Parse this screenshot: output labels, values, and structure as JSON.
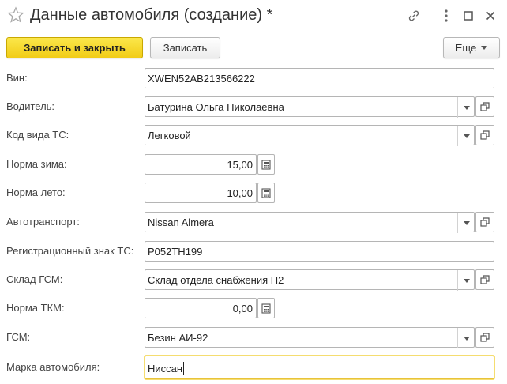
{
  "window": {
    "title": "Данные автомобиля (создание) *",
    "icons": [
      "star-icon",
      "link-icon",
      "more-vertical-icon",
      "maximize-icon",
      "close-icon"
    ]
  },
  "toolbar": {
    "save_close_label": "Записать и закрыть",
    "save_label": "Записать",
    "more_label": "Еще"
  },
  "colors": {
    "primary_button": "#f5d726",
    "active_border": "#e8c33a",
    "field_border": "#b5b5b5"
  },
  "form": {
    "vin": {
      "label": "Вин:",
      "value": "XWEN52AB213566222"
    },
    "driver": {
      "label": "Водитель:",
      "value": "Батурина Ольга Николаевна"
    },
    "vehicle_type_code": {
      "label": "Код вида ТС:",
      "value": "Легковой"
    },
    "winter_norm": {
      "label": "Норма зима:",
      "value": "15,00"
    },
    "summer_norm": {
      "label": "Норма лето:",
      "value": "10,00"
    },
    "vehicle": {
      "label": "Автотранспорт:",
      "value": "Nissan Almera"
    },
    "registration_plate": {
      "label": "Регистрационный знак ТС:",
      "value": "Р052ТН199"
    },
    "fuel_warehouse": {
      "label": "Склад ГСМ:",
      "value": "Склад отдела снабжения П2"
    },
    "tkm_norm": {
      "label": "Норма ТКМ:",
      "value": "0,00"
    },
    "fuel": {
      "label": "ГСМ:",
      "value": "Безин АИ-92"
    },
    "car_brand": {
      "label": "Марка автомобиля:",
      "value": "Ниссан"
    }
  }
}
